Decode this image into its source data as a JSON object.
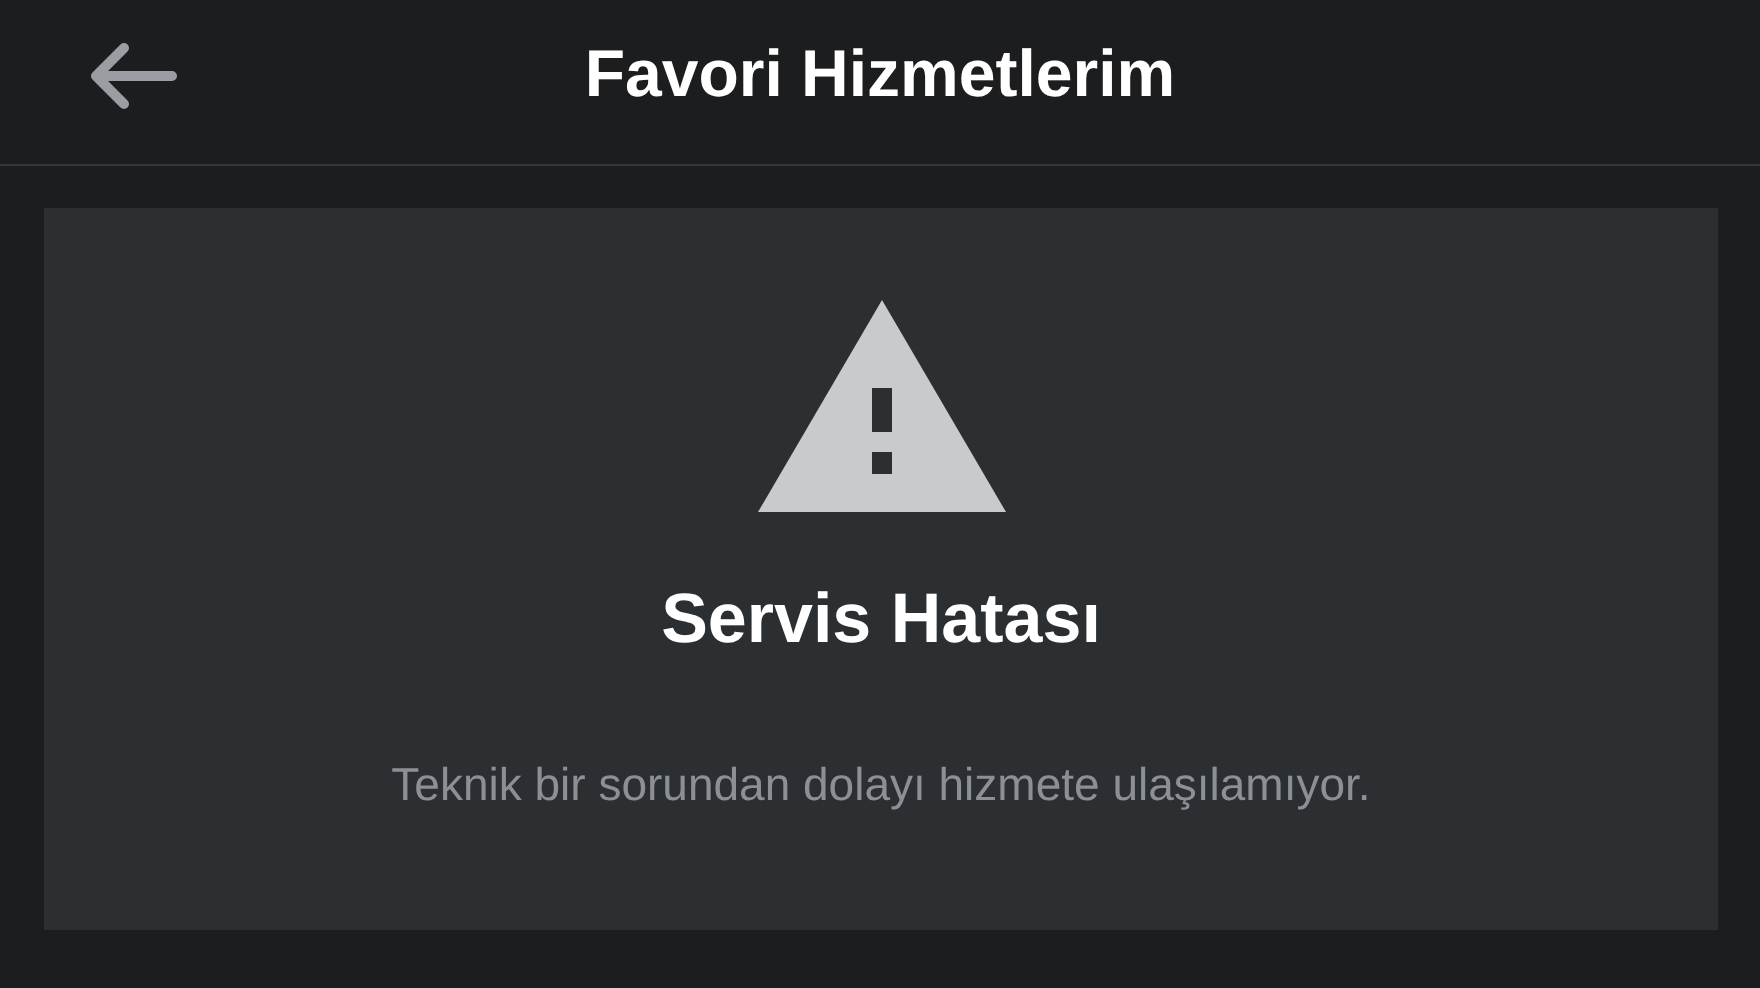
{
  "header": {
    "title": "Favori Hizmetlerim"
  },
  "error": {
    "title": "Servis Hatası",
    "message": "Teknik bir sorundan dolayı hizmete ulaşılamıyor."
  }
}
